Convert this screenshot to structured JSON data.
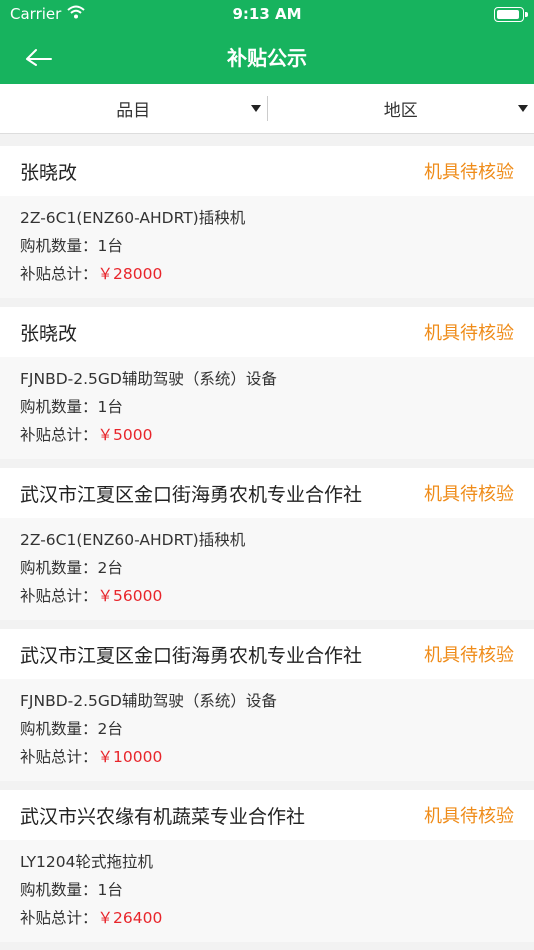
{
  "status_bar": {
    "carrier": "Carrier",
    "time": "9:13 AM"
  },
  "nav": {
    "title": "补贴公示"
  },
  "filters": {
    "category": "品目",
    "region": "地区"
  },
  "labels": {
    "quantity": "购机数量：",
    "subsidy": "补贴总计："
  },
  "colors": {
    "brand": "#17b35e",
    "status": "#ef8c1a",
    "money": "#e8252b"
  },
  "items": [
    {
      "name": "张晓改",
      "status": "机具待核验",
      "machine": "2Z-6C1(ENZ60-AHDRT)插秧机",
      "quantity": "1台",
      "amount": "￥28000"
    },
    {
      "name": "张晓改",
      "status": "机具待核验",
      "machine": "FJNBD-2.5GD辅助驾驶（系统）设备",
      "quantity": "1台",
      "amount": "￥5000"
    },
    {
      "name": "武汉市江夏区金口街海勇农机专业合作社",
      "status": "机具待核验",
      "machine": "2Z-6C1(ENZ60-AHDRT)插秧机",
      "quantity": "2台",
      "amount": "￥56000"
    },
    {
      "name": "武汉市江夏区金口街海勇农机专业合作社",
      "status": "机具待核验",
      "machine": "FJNBD-2.5GD辅助驾驶（系统）设备",
      "quantity": "2台",
      "amount": "￥10000"
    },
    {
      "name": "武汉市兴农缘有机蔬菜专业合作社",
      "status": "机具待核验",
      "machine": "LY1204轮式拖拉机",
      "quantity": "1台",
      "amount": "￥26400"
    }
  ]
}
